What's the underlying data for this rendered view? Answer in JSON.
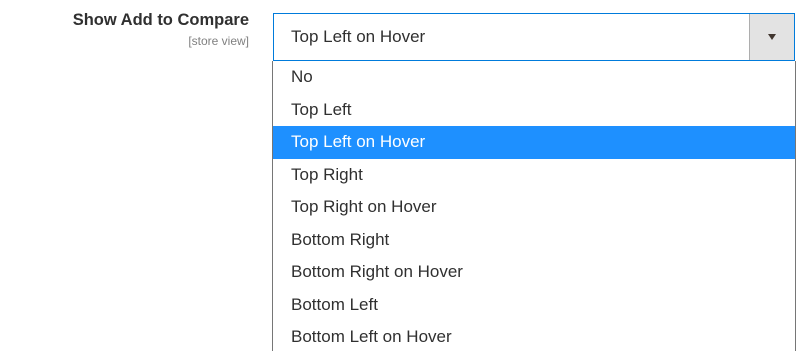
{
  "field": {
    "label": "Show Add to Compare",
    "scope": "[store view]"
  },
  "select": {
    "value": "Top Left on Hover",
    "options": [
      "No",
      "Top Left",
      "Top Left on Hover",
      "Top Right",
      "Top Right on Hover",
      "Bottom Right",
      "Bottom Right on Hover",
      "Bottom Left",
      "Bottom Left on Hover"
    ],
    "selected_index": 2
  },
  "icons": {
    "dropdown_arrow": "chevron-down-icon"
  },
  "colors": {
    "highlight": "#1e90ff",
    "focus_border": "#007bdb"
  }
}
